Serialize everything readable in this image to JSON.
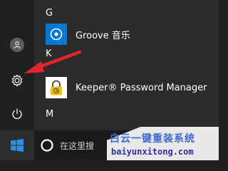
{
  "start_menu": {
    "sections": [
      {
        "letter": "G",
        "apps": [
          {
            "name": "Groove 音乐",
            "icon": "groove-music-icon",
            "tile_color": "#0078d7"
          }
        ]
      },
      {
        "letter": "K",
        "apps": [
          {
            "name": "Keeper® Password Manager",
            "icon": "keeper-lock-icon",
            "tile_color": "#ffffff"
          }
        ]
      },
      {
        "letter": "M",
        "apps": []
      }
    ],
    "rail": [
      {
        "icon": "user-avatar-icon"
      },
      {
        "icon": "settings-gear-icon"
      },
      {
        "icon": "power-icon"
      }
    ]
  },
  "taskbar": {
    "start_icon": "windows-logo-icon",
    "search_placeholder": "在这里搜"
  },
  "watermark": {
    "title": "白云一键重装系统",
    "url": "baiyunxitong.com"
  },
  "colors": {
    "accent": "#0078d7",
    "arrow": "#e3262b"
  }
}
